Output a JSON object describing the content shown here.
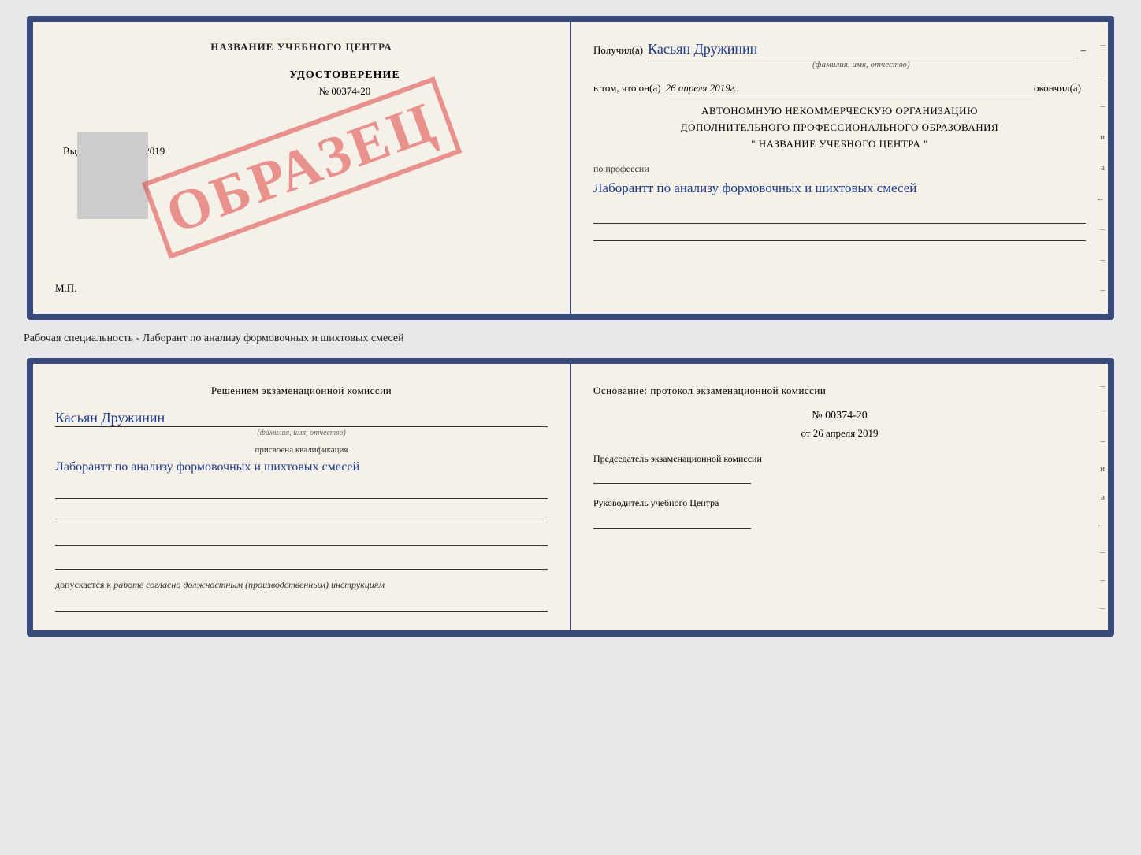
{
  "topCard": {
    "left": {
      "title": "НАЗВАНИЕ УЧЕБНОГО ЦЕНТРА",
      "udostoverenie": "УДОСТОВЕРЕНИЕ",
      "number": "№ 00374-20",
      "vydano_label": "Выдано",
      "vydano_date": "26 апреля 2019",
      "mp": "М.П.",
      "stamp": "ОБРАЗЕЦ"
    },
    "right": {
      "poluchil_label": "Получил(а)",
      "name_handwritten": "Касьян Дружинин",
      "name_subtext": "(фамилия, имя, отчество)",
      "vtom_label": "в том, что он(а)",
      "vtom_date": "26 апреля 2019г.",
      "okonchil_label": "окончил(а)",
      "org_line1": "АВТОНОМНУЮ НЕКОММЕРЧЕСКУЮ ОРГАНИЗАЦИЮ",
      "org_line2": "ДОПОЛНИТЕЛЬНОГО ПРОФЕССИОНАЛЬНОГО ОБРАЗОВАНИЯ",
      "org_line3": "\"   НАЗВАНИЕ УЧЕБНОГО ЦЕНТРА   \"",
      "profession_label": "по профессии",
      "profession_handwritten": "Лаборантт по анализу формовочных и шихтовых смесей",
      "edge_marks": [
        "–",
        "–",
        "–",
        "и",
        "а",
        "←",
        "–",
        "–",
        "–"
      ]
    }
  },
  "specialtyText": "Рабочая специальность - Лаборант по анализу формовочных и шихтовых смесей",
  "bottomCard": {
    "left": {
      "title": "Решением  экзаменационной  комиссии",
      "name_handwritten": "Касьян  Дружинин",
      "name_subtext": "(фамилия, имя, отчество)",
      "prisvoena_label": "присвоена квалификация",
      "qualification_handwritten": "Лаборантт по анализу формовочных и шихтовых смесей",
      "dopuskaetsya_label": "допускается к",
      "dopuskaetsya_text": "работе согласно должностным (производственным) инструкциям"
    },
    "right": {
      "osnov_label": "Основание: протокол экзаменационной  комиссии",
      "protocol_number": "№  00374-20",
      "protocol_date_prefix": "от",
      "protocol_date": "26 апреля 2019",
      "chairman_title": "Председатель экзаменационной комиссии",
      "rukovoditel_title": "Руководитель учебного Центра",
      "edge_marks": [
        "–",
        "–",
        "–",
        "и",
        "а",
        "←",
        "–",
        "–",
        "–"
      ]
    }
  }
}
